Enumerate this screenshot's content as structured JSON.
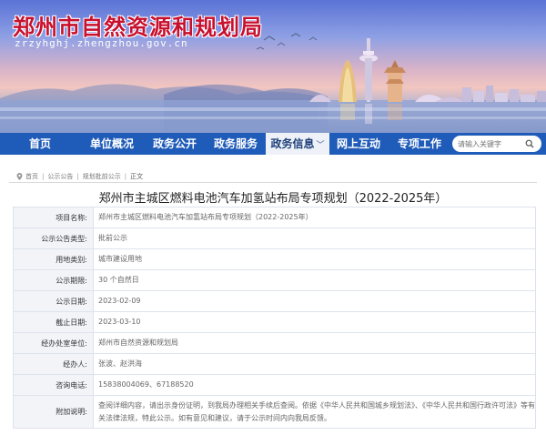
{
  "header": {
    "site_title": "郑州市自然资源和规划局",
    "site_url": "zrzyhghj.zhengzhou.gov.cn"
  },
  "nav": {
    "items": [
      {
        "label": "首页"
      },
      {
        "label": "单位概况"
      },
      {
        "label": "政务公开"
      },
      {
        "label": "政务服务"
      },
      {
        "label": "政务信息",
        "active": true
      },
      {
        "label": "网上互动"
      },
      {
        "label": "专项工作"
      }
    ],
    "active_chevron": "﹀",
    "search": {
      "placeholder": "请输入关键字",
      "icon": "search-icon"
    }
  },
  "breadcrumb": {
    "icon": "location-icon",
    "items": [
      "首页",
      "公示公告",
      "规划批前公示",
      "正文"
    ]
  },
  "page": {
    "title": "郑州市主城区燃料电池汽车加氢站布局专项规划（2022-2025年）"
  },
  "info_table": {
    "rows": [
      {
        "label": "项目名称:",
        "value": "郑州市主城区燃料电池汽车加氢站布局专项规划（2022-2025年）"
      },
      {
        "label": "公示公告类型:",
        "value": "批前公示"
      },
      {
        "label": "用地类别:",
        "value": "城市建设用地"
      },
      {
        "label": "公示期限:",
        "value": "30 个自然日"
      },
      {
        "label": "公示日期:",
        "value": "2023-02-09"
      },
      {
        "label": "截止日期:",
        "value": "2023-03-10"
      },
      {
        "label": "经办处室单位:",
        "value": "郑州市自然资源和规划局"
      },
      {
        "label": "经办人:",
        "value": "张波、赵洪海"
      },
      {
        "label": "咨询电话:",
        "value": "15838004069、67188520"
      },
      {
        "label": "附加说明:",
        "value": "查阅详细内容，请出示身份证明，到我局办理相关手续后查阅。依据《中华人民共和国城乡规划法》、《中华人民共和国行政许可法》等有关法律法规，特此公示。如有意见和建议，请于公示时间内向我局反馈。"
      }
    ]
  },
  "colors": {
    "nav_bg": "#1f5bb8",
    "title_red": "#c8102e",
    "label_bg": "#f2f4f8"
  }
}
